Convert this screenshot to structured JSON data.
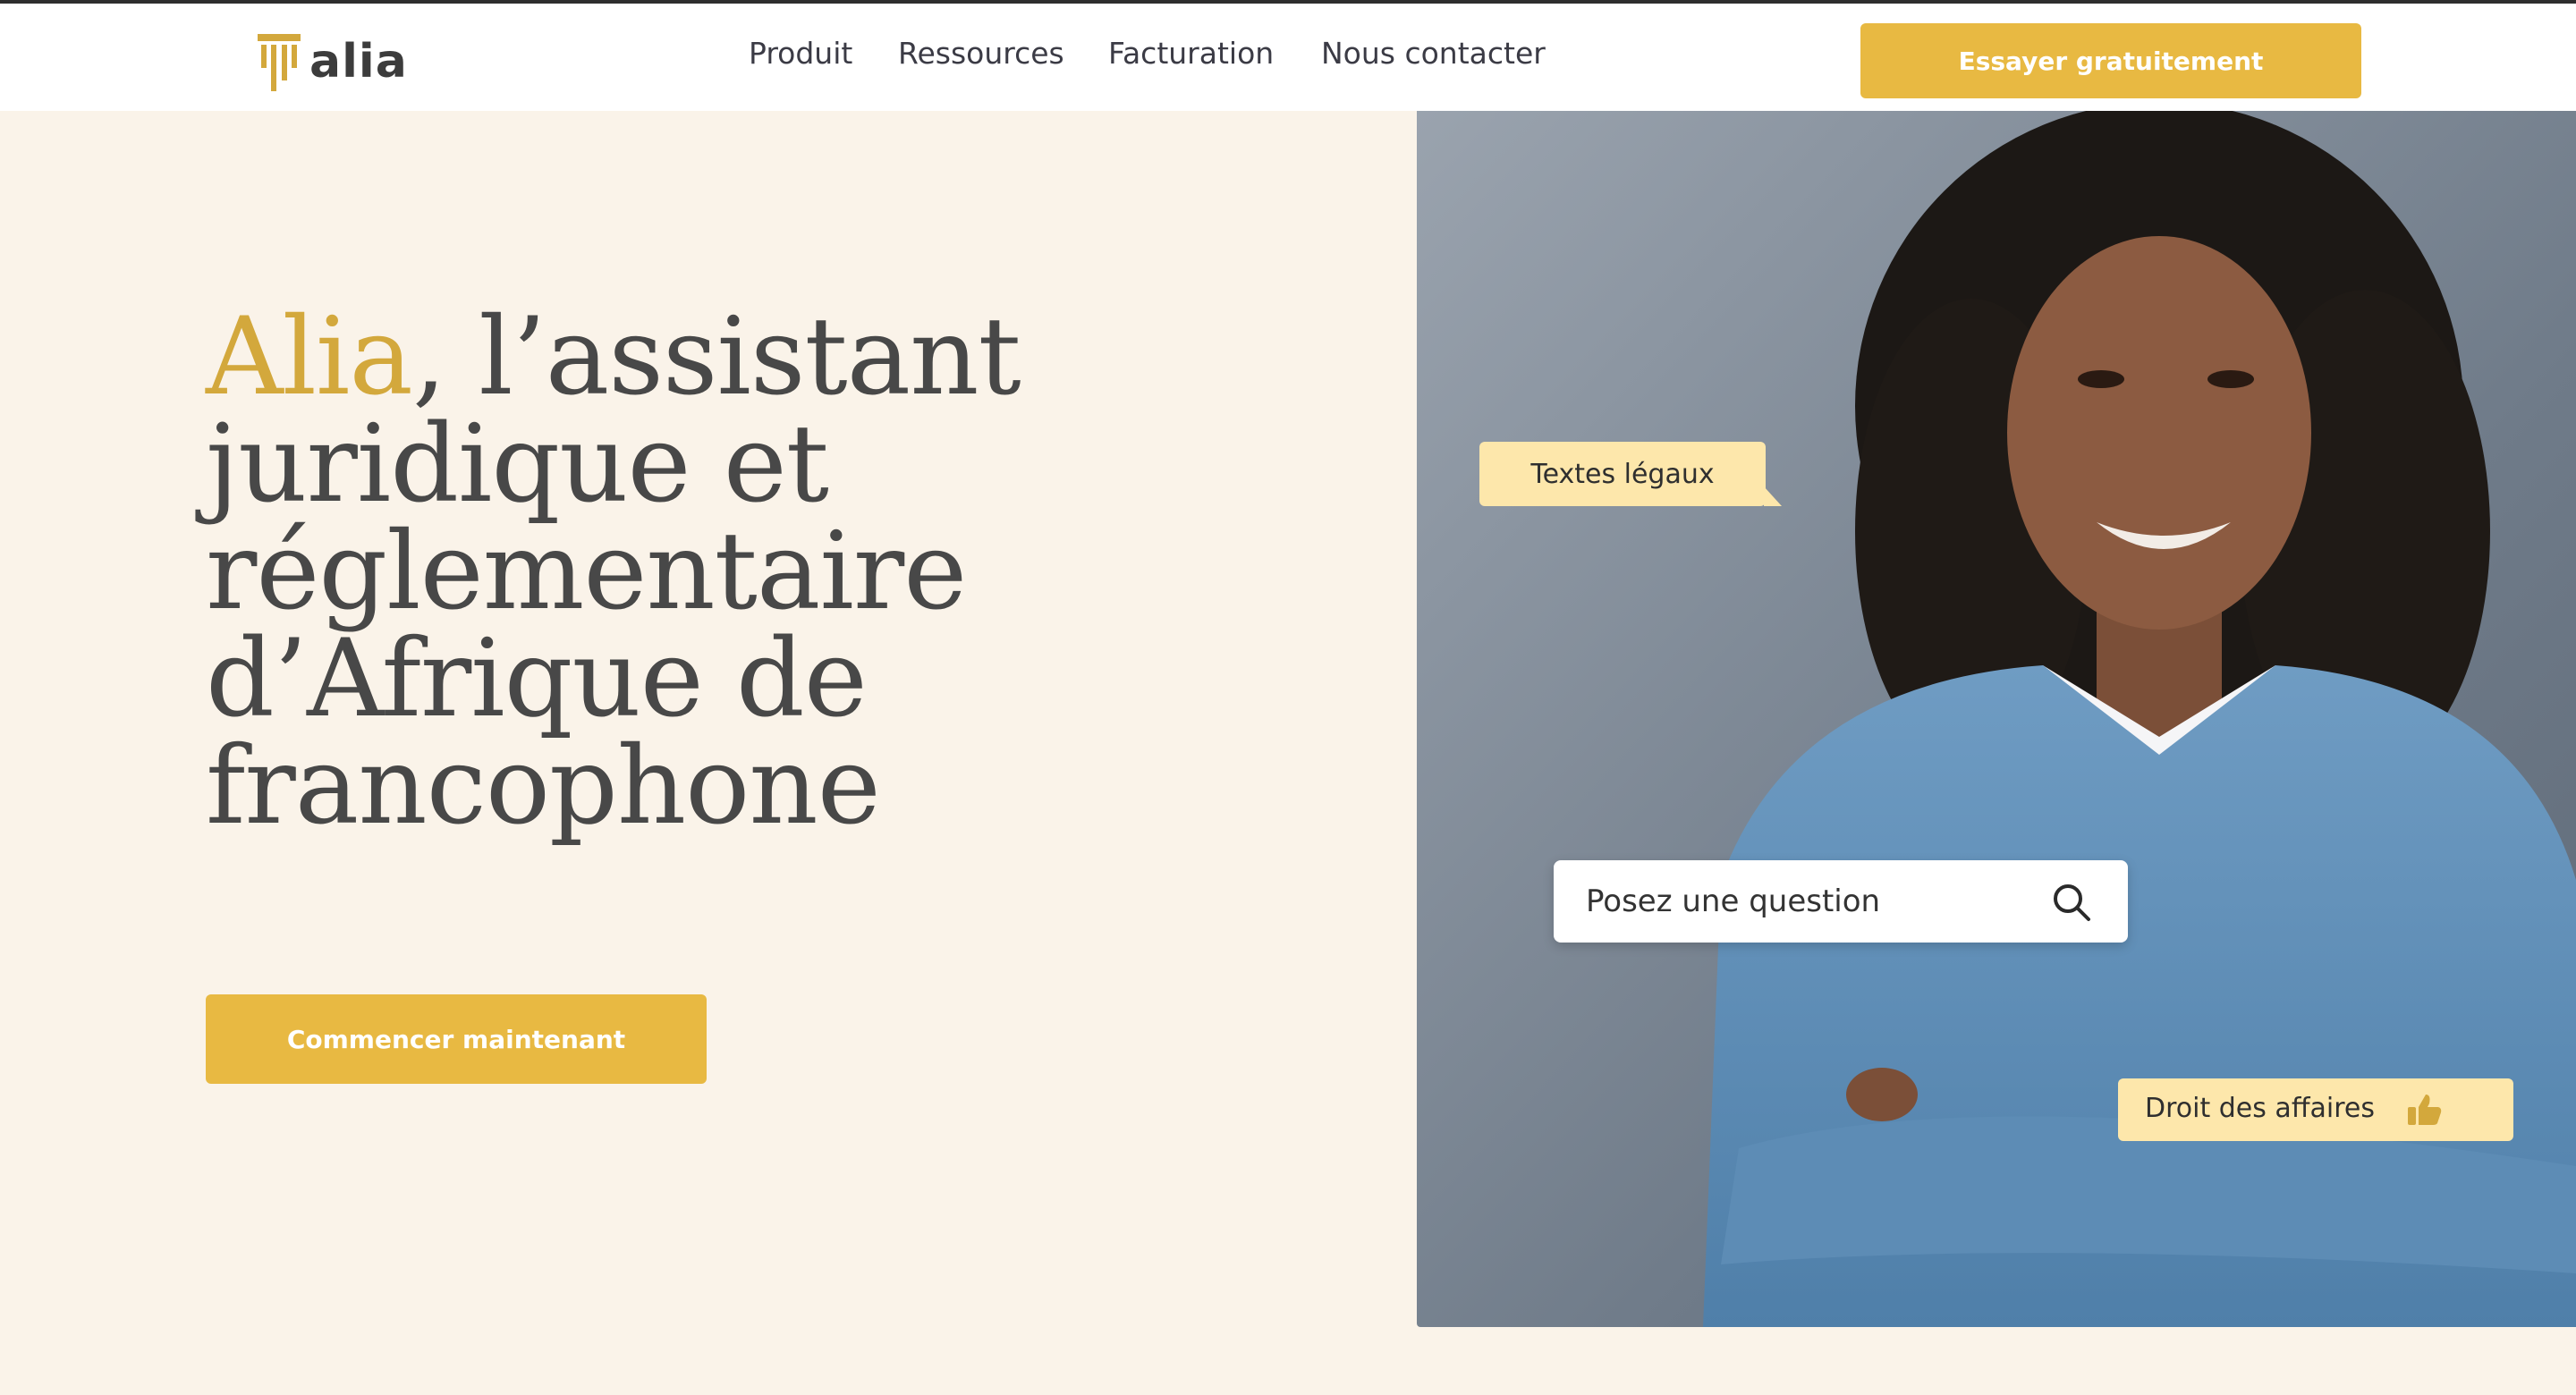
{
  "header": {
    "logo_text": "alia",
    "nav": [
      {
        "label": "Produit"
      },
      {
        "label": "Ressources"
      },
      {
        "label": "Facturation"
      },
      {
        "label": "Nous contacter"
      }
    ],
    "cta_label": "Essayer gratuitement"
  },
  "hero": {
    "title_brand": "Alia",
    "title_rest": ", l’assistant juridique et réglementaire d’Afrique de francophone",
    "cta_label": "Commencer maintenant"
  },
  "image_overlay": {
    "chip_top": "Textes légaux",
    "search_placeholder": "Posez une question",
    "chip_bottom": "Droit des affaires"
  },
  "colors": {
    "accent": "#e8b942",
    "brand_text": "#d3a83c",
    "page_background": "#faf3e9",
    "chip_background": "#fde7ab",
    "heading_text": "#484848"
  },
  "icons": [
    "logo-pillar-icon",
    "search-icon",
    "thumbs-up-icon"
  ]
}
